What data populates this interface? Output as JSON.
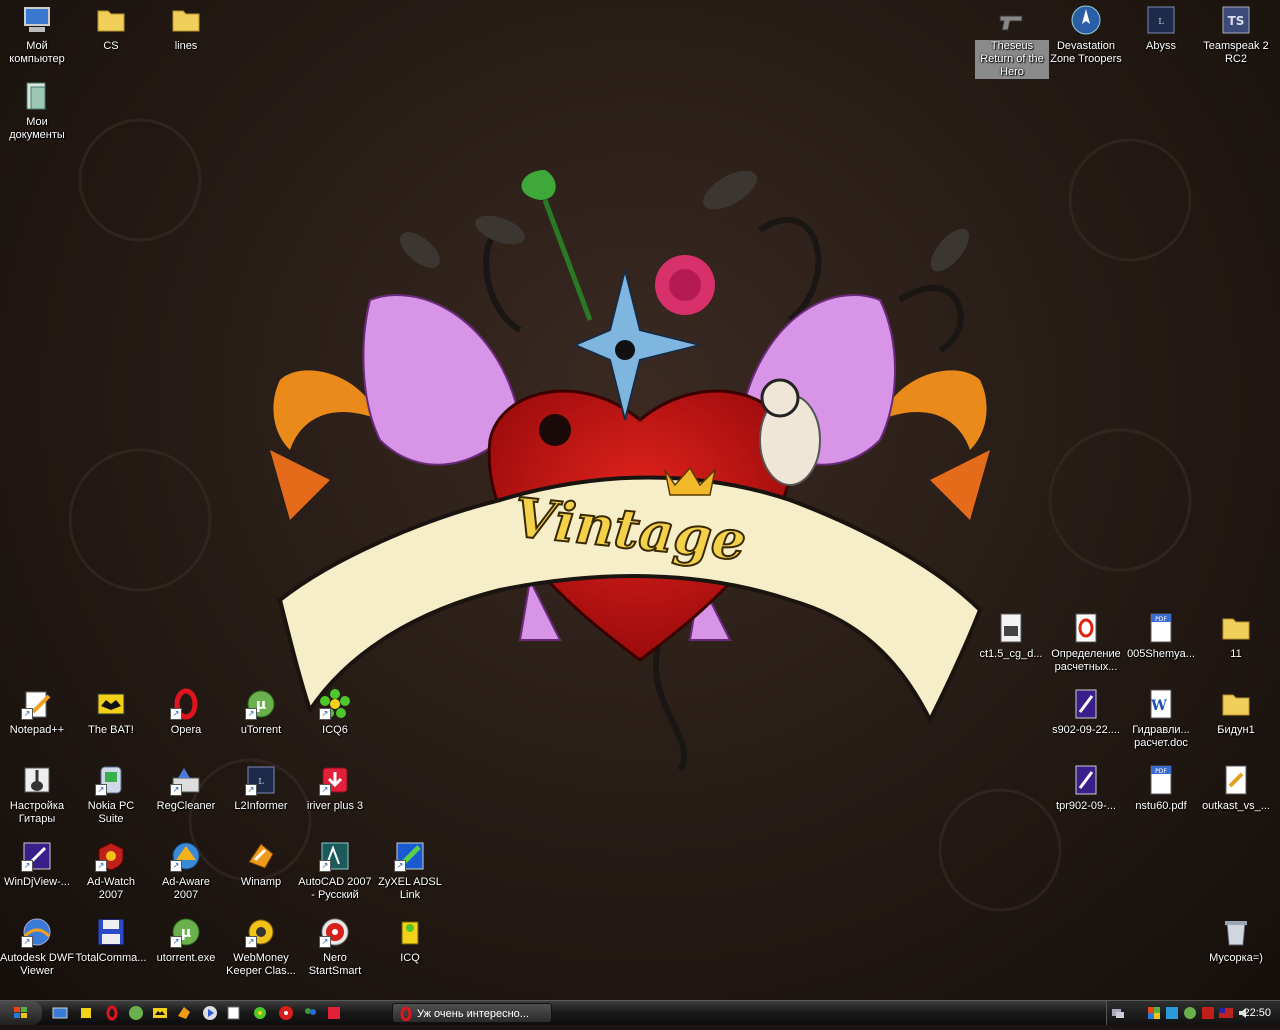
{
  "desktop": {
    "icons": [
      {
        "label": "Мой компьютер",
        "icon": "computer-icon"
      },
      {
        "label": "CS",
        "icon": "folder-icon"
      },
      {
        "label": "lines",
        "icon": "folder-icon"
      },
      {
        "label": "Мои документы",
        "icon": "my-documents-icon"
      },
      {
        "label": "Theseus Return of the Hero",
        "icon": "revolver-icon"
      },
      {
        "label": "Devastation Zone Troopers",
        "icon": "devastation-icon"
      },
      {
        "label": "Abyss",
        "icon": "lineage-icon"
      },
      {
        "label": "Teamspeak 2 RC2",
        "icon": "teamspeak-icon"
      },
      {
        "label": "ct1.5_cg_d...",
        "icon": "media-file-icon"
      },
      {
        "label": "Определение расчетных...",
        "icon": "opera-doc-icon"
      },
      {
        "label": "005Shemya...",
        "icon": "pdf-icon"
      },
      {
        "label": "11",
        "icon": "folder-icon"
      },
      {
        "label": "s902-09-22....",
        "icon": "djvu-icon"
      },
      {
        "label": "Гидравли... расчет.doc",
        "icon": "word-doc-icon"
      },
      {
        "label": "Бидун1",
        "icon": "folder-icon"
      },
      {
        "label": "tpr902-09-...",
        "icon": "djvu-icon"
      },
      {
        "label": "nstu60.pdf",
        "icon": "pdf-icon"
      },
      {
        "label": "outkast_vs_...",
        "icon": "text-file-icon"
      },
      {
        "label": "Notepad++",
        "icon": "notepad-icon"
      },
      {
        "label": "The BAT!",
        "icon": "bat-icon"
      },
      {
        "label": "Opera",
        "icon": "opera-icon"
      },
      {
        "label": "uTorrent",
        "icon": "utorrent-icon"
      },
      {
        "label": "ICQ6",
        "icon": "icq-icon"
      },
      {
        "label": "Настройка Гитары",
        "icon": "guitar-icon"
      },
      {
        "label": "Nokia PC Suite",
        "icon": "nokia-icon"
      },
      {
        "label": "RegCleaner",
        "icon": "regcleaner-icon"
      },
      {
        "label": "L2Informer",
        "icon": "lineage-icon"
      },
      {
        "label": "iriver plus 3",
        "icon": "iriver-icon"
      },
      {
        "label": "WinDjView-...",
        "icon": "djvu-icon"
      },
      {
        "label": "Ad-Watch 2007",
        "icon": "adwatch-icon"
      },
      {
        "label": "Ad-Aware 2007",
        "icon": "adaware-icon"
      },
      {
        "label": "Winamp",
        "icon": "winamp-icon"
      },
      {
        "label": "AutoCAD 2007 - Русский",
        "icon": "autocad-icon"
      },
      {
        "label": "ZyXEL ADSL Link",
        "icon": "zyxel-icon"
      },
      {
        "label": "Autodesk DWF Viewer",
        "icon": "dwf-icon"
      },
      {
        "label": "TotalComma...",
        "icon": "floppy-icon"
      },
      {
        "label": "utorrent.exe",
        "icon": "utorrent-icon"
      },
      {
        "label": "WebMoney Keeper Clas...",
        "icon": "webmoney-icon"
      },
      {
        "label": "Nero StartSmart",
        "icon": "nero-icon"
      },
      {
        "label": "ICQ",
        "icon": "icq-icon"
      },
      {
        "label": "Мусорка=)",
        "icon": "recycle-bin-icon"
      }
    ]
  },
  "taskbar": {
    "task_label": "Уж очень интересно...",
    "clock": "22:50"
  }
}
